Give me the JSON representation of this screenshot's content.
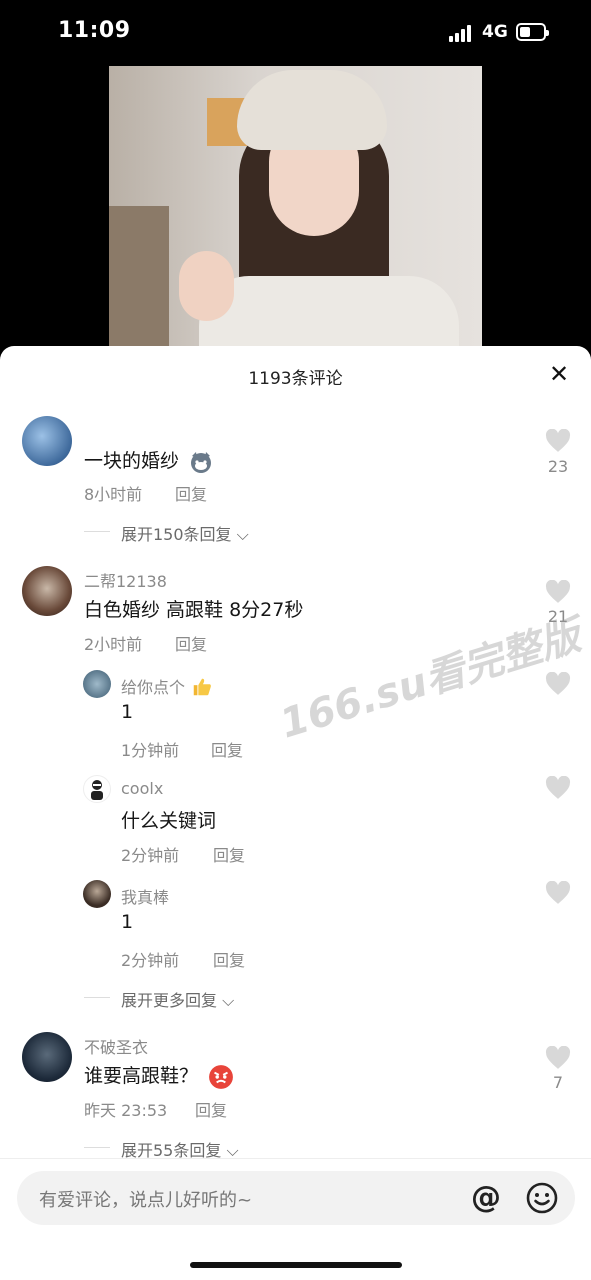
{
  "status_bar": {
    "time": "11:09",
    "network": "4G"
  },
  "sheet": {
    "title": "1193条评论"
  },
  "comments": [
    {
      "username": "",
      "text": "一块的婚纱",
      "time": "8小时前",
      "reply": "回复",
      "likes": "23",
      "expand": "展开150条回复"
    },
    {
      "username": "二帮12138",
      "text": "白色婚纱 高跟鞋 8分27秒",
      "time": "2小时前",
      "reply": "回复",
      "likes": "21"
    },
    {
      "username": "不破圣衣",
      "text": "谁要高跟鞋？",
      "time": "昨天 23:53",
      "reply": "回复",
      "likes": "7",
      "expand": "展开55条回复"
    }
  ],
  "replies": [
    {
      "username": "给你点个",
      "text": "1",
      "time": "1分钟前",
      "reply": "回复"
    },
    {
      "username": "coolx",
      "text": "什么关键词",
      "time": "2分钟前",
      "reply": "回复"
    },
    {
      "username": "我真棒",
      "text": "1",
      "time": "2分钟前",
      "reply": "回复"
    }
  ],
  "expand_more": "展开更多回复",
  "watermark": "166.su看完整版",
  "input": {
    "placeholder": "有爱评论，说点儿好听的~",
    "at_symbol": "@"
  }
}
